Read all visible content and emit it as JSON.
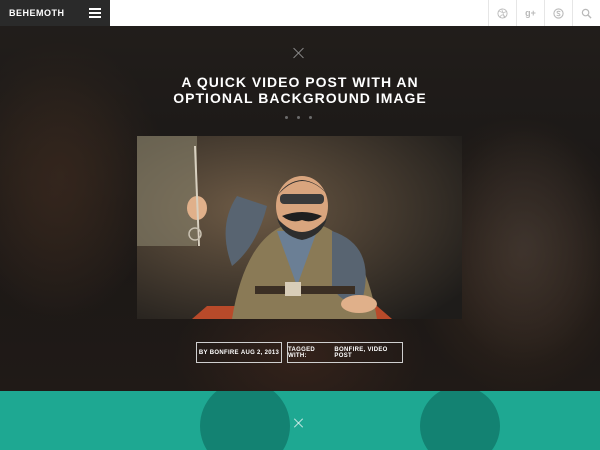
{
  "brand": {
    "name": "BEHEMOTH"
  },
  "topbar": {
    "menu_icon": "hamburger-icon",
    "social_icons": [
      "dribbble-icon",
      "google-plus-icon",
      "skype-icon",
      "search-icon"
    ],
    "google_plus_text": "g+"
  },
  "post": {
    "title_line1": "A QUICK VIDEO POST WITH AN",
    "title_line2": "OPTIONAL BACKGROUND IMAGE",
    "meta_by_prefix": "BY ",
    "meta_author": "BONFIRE",
    "meta_date": "AUG 2, 2013",
    "meta_tags_prefix": "TAGGED WITH: ",
    "meta_tags": [
      "BONFIRE",
      "VIDEO POST"
    ],
    "meta_tags_joined": "BONFIRE, VIDEO POST"
  },
  "colors": {
    "teal": "#1ea892",
    "topbar_bg": "#ffffff",
    "brand_bg": "#2a2a2a"
  }
}
